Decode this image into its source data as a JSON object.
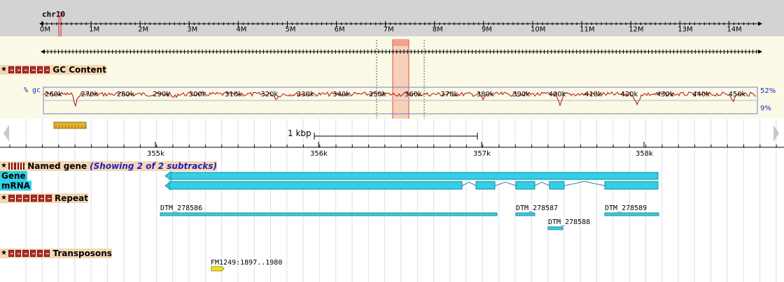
{
  "overview": {
    "chromosome": "chr10",
    "ticks": [
      "0M",
      "1M",
      "2M",
      "3M",
      "4M",
      "5M",
      "6M",
      "7M",
      "8M",
      "9M",
      "10M",
      "11M",
      "12M",
      "13M",
      "14M"
    ]
  },
  "detail_ruler": {
    "ticks": [
      "260k",
      "270k",
      "280k",
      "290k",
      "300k",
      "310k",
      "320k",
      "330k",
      "340k",
      "350k",
      "360k",
      "370k",
      "380k",
      "390k",
      "400k",
      "410k",
      "420k",
      "430k",
      "440k",
      "450k"
    ]
  },
  "gc_track": {
    "title": "GC Content",
    "y_label": "% gc",
    "max_label": "52%",
    "min_label": "9%"
  },
  "scale": {
    "label": "1 kbp",
    "ticks": [
      "355k",
      "356k",
      "357k",
      "358k"
    ]
  },
  "named_gene_track": {
    "title": "Named gene",
    "subtitle": "(Showing 2 of 2 subtracks)",
    "sub_labels": [
      "Gene",
      "mRNA"
    ]
  },
  "repeat_track": {
    "title": "Repeat",
    "features": [
      "DTM_278586",
      "DTM_278587",
      "DTM_278588",
      "DTM_278589"
    ]
  },
  "transposons_track": {
    "title": "Transposons",
    "features": [
      "FM1249:1897..1980"
    ]
  },
  "colors": {
    "overview_bg": "#d3d3d3",
    "ruler_bg": "#fafae6",
    "track_header": "#f5d7b4",
    "feature": "#30d0e8",
    "gc_line": "#b01010",
    "highlight": "#f5c8b0"
  }
}
